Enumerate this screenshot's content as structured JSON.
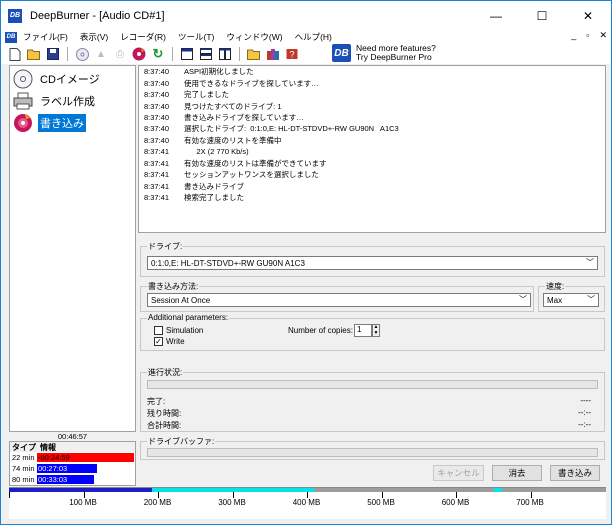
{
  "window": {
    "app_icon": "DB",
    "title": "DeepBurner - [Audio CD#1]",
    "controls": {
      "minimize": "—",
      "maximize": "☐",
      "close": "✕"
    }
  },
  "menu": {
    "items": [
      "ファイル(F)",
      "表示(V)",
      "レコーダ(R)",
      "ツール(T)",
      "ウィンドウ(W)",
      "ヘルプ(H)"
    ],
    "mdi_controls": {
      "minimize": "_",
      "restore": "▫",
      "close": "✕"
    }
  },
  "toolbar": {
    "icons": [
      "new-icon",
      "open-icon",
      "save-icon",
      "disc-icon",
      "eject-icon",
      "print-icon",
      "burn-icon",
      "refresh-icon",
      "window-icon",
      "tile-horizontal-icon",
      "tile-vertical-icon",
      "folder-icon",
      "books-icon",
      "help-icon"
    ],
    "promo": {
      "logo": "DB",
      "line1": "Need more features?",
      "line2": "Try DeepBurner Pro"
    }
  },
  "nav": {
    "items": [
      {
        "label": "CDイメージ",
        "icon": "cd-image-icon"
      },
      {
        "label": "ラベル作成",
        "icon": "printer-icon"
      },
      {
        "label": "書き込み",
        "icon": "burn-disc-icon",
        "selected": true
      }
    ]
  },
  "capacity": {
    "total_time": "00:46:57",
    "headers": {
      "type": "タイプ",
      "info": "情報"
    },
    "rows": [
      {
        "min": "22 min",
        "info": "-00:24:59",
        "color": "#ff0000",
        "fill": 1.0
      },
      {
        "min": "74 min",
        "info": "00:27:03",
        "color": "#0000ff",
        "fill": 0.62
      },
      {
        "min": "80 min",
        "info": "00:33:03",
        "color": "#0000ff",
        "fill": 0.59
      }
    ]
  },
  "log": {
    "entries": [
      {
        "time": "8:37:40",
        "msg": "ASPI初期化しました"
      },
      {
        "time": "8:37:40",
        "msg": "使用できるなドライブを探しています…"
      },
      {
        "time": "8:37:40",
        "msg": "完了しました"
      },
      {
        "time": "8:37:40",
        "msg": "見つけたすべてのドライブ: 1"
      },
      {
        "time": "8:37:40",
        "msg": "書き込みドライブを探しています…"
      },
      {
        "time": "8:37:40",
        "msg": "選択したドライブ:  0:1:0,E: HL-DT-STDVD+-RW GU90N   A1C3"
      },
      {
        "time": "8:37:40",
        "msg": "有効な速度のリストを準備中"
      },
      {
        "time": "8:37:41",
        "msg": "      2X (2 770 Kb/s)"
      },
      {
        "time": "8:37:41",
        "msg": "有効な速度のリストは準備ができています"
      },
      {
        "time": "8:37:41",
        "msg": "セッションアットワンスを選択しました"
      },
      {
        "time": "8:37:41",
        "msg": "書き込みドライブ"
      },
      {
        "time": "8:37:41",
        "msg": "検索完了しました"
      }
    ]
  },
  "drive": {
    "group_label": "ドライブ:",
    "selected": "0:1:0,E: HL-DT-STDVD+-RW GU90N    A1C3"
  },
  "write_method": {
    "group_label": "書き込み方法:",
    "selected": "Session At Once"
  },
  "speed": {
    "group_label": "速度:",
    "selected": "Max"
  },
  "params": {
    "group_label": "Additional parameters:",
    "simulation": {
      "label": "Simulation",
      "checked": false
    },
    "write": {
      "label": "Write",
      "checked": true
    },
    "copies_label": "Number of copies:",
    "copies_value": "1"
  },
  "progress": {
    "group_label": "進行状況:",
    "complete_label": "完了:",
    "complete_value": "----",
    "remaining_label": "残り時間:",
    "remaining_value": "--:--",
    "total_label": "合計時間:",
    "total_value": "--:--"
  },
  "buffer": {
    "group_label": "ドライブバッファ:"
  },
  "buttons": {
    "cancel": "キャンセル",
    "erase": "消去",
    "burn": "書き込み"
  },
  "ruler": {
    "labels": [
      "100 MB",
      "200 MB",
      "300 MB",
      "400 MB",
      "500 MB",
      "600 MB",
      "700 MB"
    ],
    "colors": {
      "used": "#1c1cc8",
      "cd": "#00e5e5",
      "over": "#9c9c9c"
    }
  }
}
